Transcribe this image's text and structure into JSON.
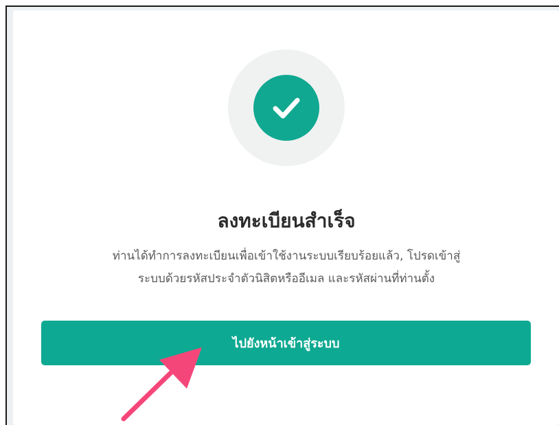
{
  "registration": {
    "title": "ลงทะเบียนสำเร็จ",
    "description_line1": "ท่านได้ทำการลงทะเบียนเพื่อเข้าใช้งานระบบเรียบร้อยแล้ว, โปรดเข้าสู่",
    "description_line2": "ระบบด้วยรหัสประจำตัวนิสิตหรืออีเมล และรหัสผ่านที่ท่านตั้ง",
    "login_button_label": "ไปยังหน้าเข้าสู่ระบบ"
  },
  "icons": {
    "success": "check-circle-icon",
    "annotation": "pointer-arrow-icon"
  },
  "colors": {
    "accent": "#0ea992",
    "annotation_arrow": "#f5467a"
  }
}
